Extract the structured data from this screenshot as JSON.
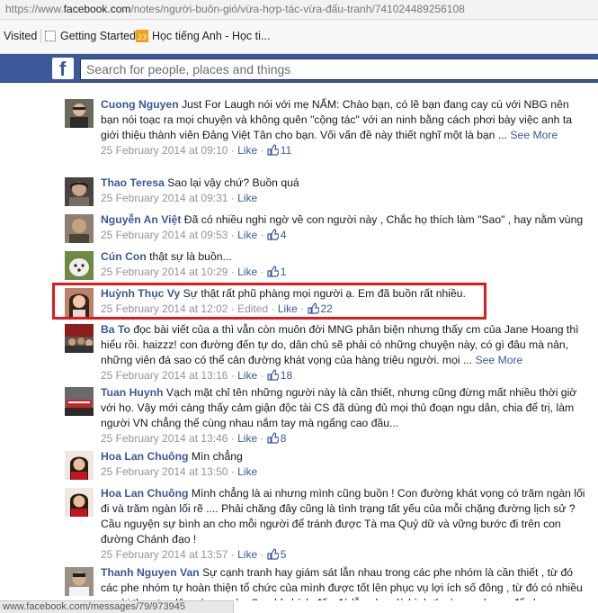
{
  "browser": {
    "url_prefix": "https://www.",
    "url_domain": "facebook.com",
    "url_path": "/notes/người-buôn-gió/vừa-hợp-tác-vừa-đấu-tranh/741024489256108",
    "bookmarks": [
      "Visited",
      "Getting Started",
      "Học tiếng Anh - Học ti..."
    ],
    "status_text": "www.facebook.com/messages/79/973945"
  },
  "header": {
    "logo": "f",
    "search_placeholder": "Search for people, places and things"
  },
  "colors": {
    "facebook_blue": "#3b5998",
    "highlight_red": "#e0191f",
    "meta_gray": "#90949c"
  },
  "comments": [
    {
      "author": "Cuong Nguyen",
      "text": "Just For Laugh nói với mẹ NẤM: Chào bạn, có lẽ bạn đang cay cú với NBG nên bạn nói toạc ra mọi chuyện và không quên \"cộng tác\" với an ninh bằng cách phơi bày việc anh ta giới thiệu thành viên Đảng Việt Tân cho bạn. Vối vấn đề này thiết nghĩ một là bạn ...",
      "see_more": "See More",
      "timestamp": "25 February 2014 at 09:10",
      "like_label": "Like",
      "likes": "11",
      "avatar_icon": "man-photo-icon"
    },
    {
      "author": "Thao Teresa",
      "text": "Sao lại vậy chứ? Buồn quá",
      "timestamp": "25 February 2014 at 09:31",
      "like_label": "Like",
      "avatar_icon": "woman-photo-icon"
    },
    {
      "author": "Nguyễn An Việt",
      "text": "Đã có nhiều nghi ngờ về con người này , Chắc họ thích làm \"Sao\" , hay nằm vùng",
      "timestamp": "25 February 2014 at 09:53",
      "like_label": "Like",
      "likes": "4",
      "avatar_icon": "portrait-icon"
    },
    {
      "author": "Cún Con",
      "text": "thật sự là buồn...",
      "timestamp": "25 February 2014 at 10:29",
      "like_label": "Like",
      "likes": "1",
      "avatar_icon": "dog-icon"
    },
    {
      "author": "Huỳnh Thục Vy",
      "text": "Sự thật rất phũ phàng mọi người ạ. Em đã buồn rất nhiều.",
      "timestamp": "25 February 2014 at 12:02",
      "edited": "Edited",
      "like_label": "Like",
      "likes": "22",
      "avatar_icon": "woman-portrait-icon"
    },
    {
      "author": "Ba To",
      "text": "đọc bài viết của a thì vẫn còn muôn đời MNG phản biện nhưng thấy cm của Jane Hoang thì hiểu rồi. haizzz! con đường đến tự do, dân chủ sẽ phải có những chuyện này, có gì đâu mà nản, những viên đá sao có thể cản đường khát vọng của hàng triệu người. mọi ...",
      "see_more": "See More",
      "timestamp": "25 February 2014 at 13:16",
      "like_label": "Like",
      "likes": "18",
      "avatar_icon": "crowd-photo-icon"
    },
    {
      "author": "Tuan Huynh",
      "text": "Vạch mặt chỉ tên những người này là cần thiết, nhưng cũng đừng mất nhiều thời giờ với họ. Vậy mới càng thấy cảm giận độc tài CS đã dùng đủ mọi thủ đoạn ngu dân, chia để trị, làm người VN chẳng thể cùng nhau nắm tay mà ngẩng cao đầu...",
      "timestamp": "25 February 2014 at 13:46",
      "like_label": "Like",
      "likes": "8",
      "avatar_icon": "protest-photo-icon"
    },
    {
      "author": "Hoa Lan Chuông",
      "text": "Mìn chẳng",
      "timestamp": "25 February 2014 at 13:50",
      "like_label": "Like",
      "avatar_icon": "woman-red-icon"
    },
    {
      "author": "Hoa Lan Chuông",
      "text": "Mình chẳng là ai nhưng mình cũng buồn ! Con đường khát vọng có trăm ngàn lối đi và trăm ngàn lối rẽ .... Phải chăng đây cũng là tình trạng tất yếu của mỗi chặng đường lịch sử ? Cầu nguyện sự bình an cho mỗi người để tránh được Tà ma Quỷ dữ và vững bước đi trên con đường Chánh đạo !",
      "timestamp": "25 February 2014 at 13:57",
      "like_label": "Like",
      "likes": "5",
      "avatar_icon": "woman-red-icon"
    },
    {
      "author": "Thanh Nguyen Van",
      "text": "Sự cạnh tranh hay giám sát lẫn nhau trong các phe nhóm là cần thiết , từ đó các phe nhóm tự hoàn thiện tổ chức của mình được tốt lên phục vụ lợi ích số đông , từ đó có nhiều người theo tạo lên sức mạnh . Sự chỉ chích đấu đá lẫn nhau là bình thường , nhưng để cho an",
      "avatar_icon": "man-portrait-icon"
    }
  ]
}
